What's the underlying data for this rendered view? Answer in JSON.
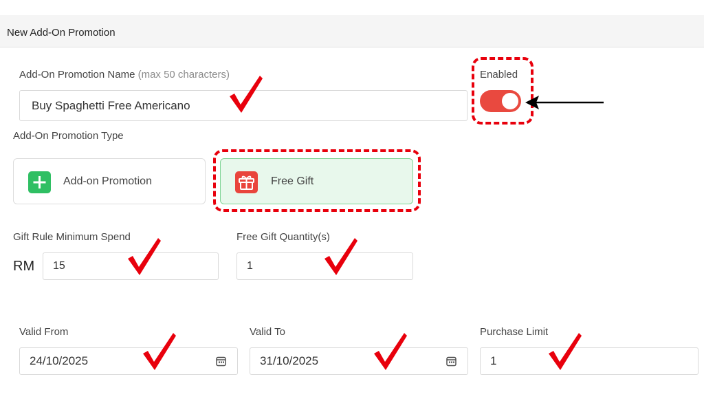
{
  "header": {
    "title": "New Add-On Promotion"
  },
  "promotion_name": {
    "label": "Add-On Promotion Name",
    "hint": "(max 50 characters)",
    "value": "Buy Spaghetti Free Americano"
  },
  "enabled": {
    "label": "Enabled",
    "state": "on"
  },
  "promotion_type": {
    "label": "Add-On Promotion Type",
    "options": [
      {
        "label": "Add-on Promotion",
        "selected": false,
        "icon": "plus-icon"
      },
      {
        "label": "Free Gift",
        "selected": true,
        "icon": "gift-icon"
      }
    ]
  },
  "min_spend": {
    "label": "Gift Rule Minimum Spend",
    "currency": "RM",
    "value": "15"
  },
  "gift_quantity": {
    "label": "Free Gift Quantity(s)",
    "value": "1"
  },
  "valid_from": {
    "label": "Valid From",
    "value": "24/10/2025",
    "icon": "calendar-icon"
  },
  "valid_to": {
    "label": "Valid To",
    "value": "31/10/2025",
    "icon": "calendar-icon"
  },
  "purchase_limit": {
    "label": "Purchase Limit",
    "value": "1"
  },
  "colors": {
    "toggle_on": "#e9493f",
    "selected_card_bg": "#e8f8ec",
    "selected_card_border": "#7fd495",
    "annotation_red": "#e8000c",
    "plus_icon_green": "#2fbf63",
    "gift_icon_red": "#e9453c"
  }
}
